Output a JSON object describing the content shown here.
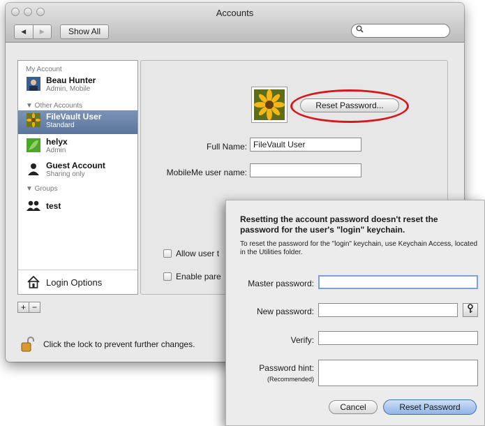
{
  "window": {
    "title": "Accounts"
  },
  "toolbar": {
    "back_glyph": "◀",
    "forward_glyph": "▶",
    "show_all": "Show All",
    "search_placeholder": ""
  },
  "sidebar": {
    "my_account_header": "My Account",
    "other_accounts_header": "▼ Other Accounts",
    "groups_header": "▼ Groups",
    "users": [
      {
        "name": "Beau Hunter",
        "role": "Admin, Mobile",
        "icon": "user-photo-icon"
      },
      {
        "name": "FileVault User",
        "role": "Standard",
        "icon": "flower-photo-icon",
        "selected": true
      },
      {
        "name": "helyx",
        "role": "Admin",
        "icon": "leaf-photo-icon"
      },
      {
        "name": "Guest Account",
        "role": "Sharing only",
        "icon": "person-silhouette-icon"
      }
    ],
    "groups": [
      {
        "name": "test",
        "icon": "group-icon"
      }
    ],
    "login_options": "Login Options"
  },
  "bottom": {
    "add": "+",
    "remove": "−",
    "lock_text": "Click the lock to prevent further changes."
  },
  "panel": {
    "reset_password_button": "Reset Password...",
    "full_name_label": "Full Name:",
    "full_name_value": "FileVault User",
    "mobileme_label": "MobileMe user name:",
    "mobileme_value": "",
    "allow_label": "Allow user t",
    "enable_label": "Enable pare"
  },
  "sheet": {
    "heading": "Resetting the account password doesn't reset the password for the user's \"login\" keychain.",
    "subtext": "To reset the password for the \"login\" keychain, use Keychain Access, located in the Utilities folder.",
    "master_label": "Master password:",
    "new_label": "New password:",
    "verify_label": "Verify:",
    "hint_label": "Password hint:",
    "hint_note": "(Recommended)",
    "cancel": "Cancel",
    "reset": "Reset Password"
  },
  "colors": {
    "highlight": "#d6181c",
    "selection": "#6a83aa"
  }
}
